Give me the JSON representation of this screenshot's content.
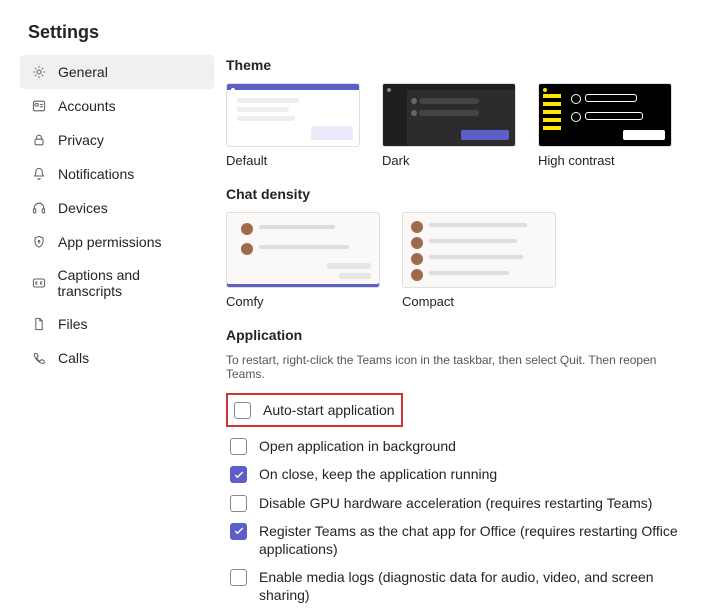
{
  "header": {
    "title": "Settings"
  },
  "sidebar": {
    "items": [
      {
        "label": "General"
      },
      {
        "label": "Accounts"
      },
      {
        "label": "Privacy"
      },
      {
        "label": "Notifications"
      },
      {
        "label": "Devices"
      },
      {
        "label": "App permissions"
      },
      {
        "label": "Captions and transcripts"
      },
      {
        "label": "Files"
      },
      {
        "label": "Calls"
      }
    ]
  },
  "sections": {
    "theme": {
      "title": "Theme",
      "options": [
        {
          "label": "Default"
        },
        {
          "label": "Dark"
        },
        {
          "label": "High contrast"
        }
      ]
    },
    "density": {
      "title": "Chat density",
      "options": [
        {
          "label": "Comfy"
        },
        {
          "label": "Compact"
        }
      ]
    },
    "application": {
      "title": "Application",
      "subtitle": "To restart, right-click the Teams icon in the taskbar, then select Quit. Then reopen Teams.",
      "checkboxes": [
        {
          "label": "Auto-start application",
          "checked": false,
          "highlight": true
        },
        {
          "label": "Open application in background",
          "checked": false
        },
        {
          "label": "On close, keep the application running",
          "checked": true
        },
        {
          "label": "Disable GPU hardware acceleration (requires restarting Teams)",
          "checked": false
        },
        {
          "label": "Register Teams as the chat app for Office (requires restarting Office applications)",
          "checked": true
        },
        {
          "label": "Enable media logs (diagnostic data for audio, video, and screen sharing)",
          "checked": false
        }
      ]
    }
  }
}
